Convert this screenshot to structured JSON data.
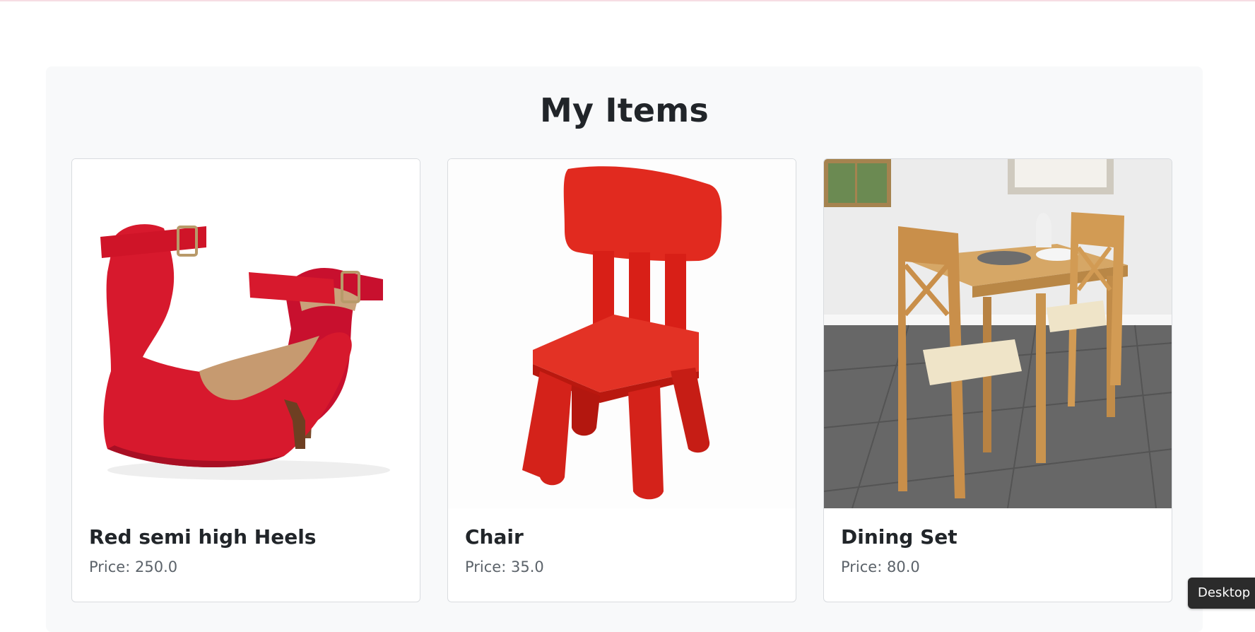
{
  "page": {
    "title": "My Items"
  },
  "items": [
    {
      "title": "Red semi high Heels",
      "price_label": "Price:",
      "price": "250.0",
      "image_icon": "red-heels-image"
    },
    {
      "title": "Chair",
      "price_label": "Price:",
      "price": "35.0",
      "image_icon": "red-chair-image"
    },
    {
      "title": "Dining Set",
      "price_label": "Price:",
      "price": "80.0",
      "image_icon": "dining-set-image"
    }
  ],
  "tooltip": {
    "text": "Desktop a"
  },
  "colors": {
    "panel_background": "#f8f9fa",
    "card_border": "#d9dcdf",
    "price_text": "#5c636a",
    "accent_red": "#e0231f"
  }
}
